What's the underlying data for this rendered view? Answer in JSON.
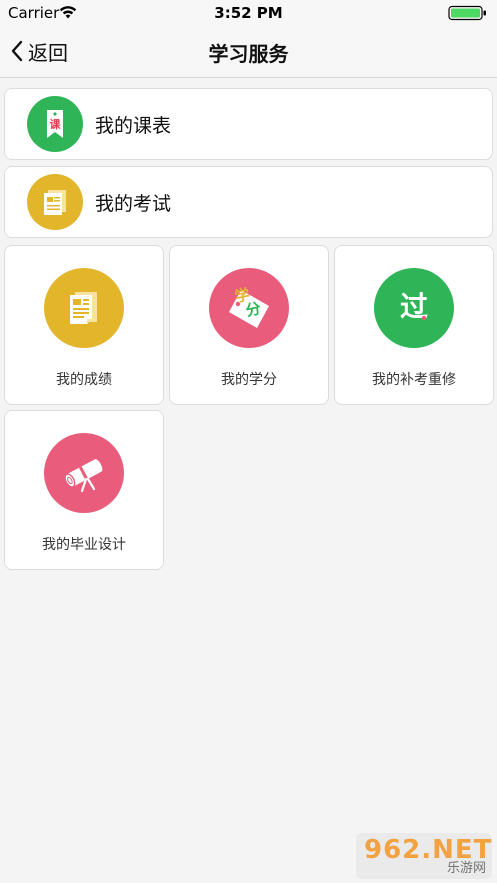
{
  "status_bar": {
    "carrier": "Carrier",
    "time": "3:52 PM"
  },
  "nav": {
    "back_label": "返回",
    "title": "学习服务"
  },
  "list_items": [
    {
      "label": "我的课表",
      "icon": "schedule-icon",
      "color": "#2fb457",
      "glyph": "课"
    },
    {
      "label": "我的考试",
      "icon": "exam-document-icon",
      "color": "#e2b52b"
    }
  ],
  "grid_items": [
    {
      "label": "我的成绩",
      "icon": "grades-document-icon",
      "color": "#e2b52b"
    },
    {
      "label": "我的学分",
      "icon": "credit-tag-icon",
      "color": "#e95c7b",
      "glyph": "学分"
    },
    {
      "label": "我的补考重修",
      "icon": "pass-icon",
      "color": "#2fb457",
      "glyph": "过"
    },
    {
      "label": "我的毕业设计",
      "icon": "diploma-scroll-icon",
      "color": "#e95c7b"
    }
  ],
  "watermark": {
    "main": "962.NET",
    "sub": "乐游网"
  },
  "colors": {
    "background": "#f4f4f4",
    "card": "#ffffff",
    "green": "#2fb457",
    "yellow": "#e2b52b",
    "pink": "#e95c7b"
  }
}
